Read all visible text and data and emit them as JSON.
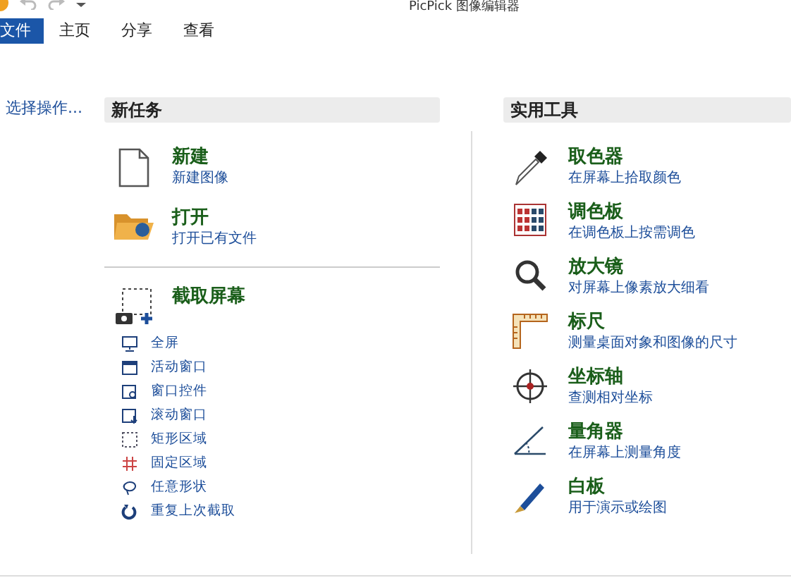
{
  "window": {
    "title": "PicPick 图像编辑器"
  },
  "tabs": [
    {
      "label": "文件",
      "selected": true
    },
    {
      "label": "主页",
      "selected": false
    },
    {
      "label": "分享",
      "selected": false
    },
    {
      "label": "查看",
      "selected": false
    }
  ],
  "sidebar": {
    "heading": "选择操作..."
  },
  "new_task": {
    "heading": "新任务",
    "items": [
      {
        "title": "新建",
        "subtitle": "新建图像"
      },
      {
        "title": "打开",
        "subtitle": "打开已有文件"
      }
    ],
    "capture": {
      "title": "截取屏幕",
      "options": [
        "全屏",
        "活动窗口",
        "窗口控件",
        "滚动窗口",
        "矩形区域",
        "固定区域",
        "任意形状",
        "重复上次截取"
      ]
    }
  },
  "tools": {
    "heading": "实用工具",
    "items": [
      {
        "title": "取色器",
        "subtitle": "在屏幕上拾取颜色"
      },
      {
        "title": "调色板",
        "subtitle": "在调色板上按需调色"
      },
      {
        "title": "放大镜",
        "subtitle": "对屏幕上像素放大细看"
      },
      {
        "title": "标尺",
        "subtitle": "测量桌面对象和图像的尺寸"
      },
      {
        "title": "坐标轴",
        "subtitle": "查测相对坐标"
      },
      {
        "title": "量角器",
        "subtitle": "在屏幕上测量角度"
      },
      {
        "title": "白板",
        "subtitle": "用于演示或绘图"
      }
    ]
  }
}
